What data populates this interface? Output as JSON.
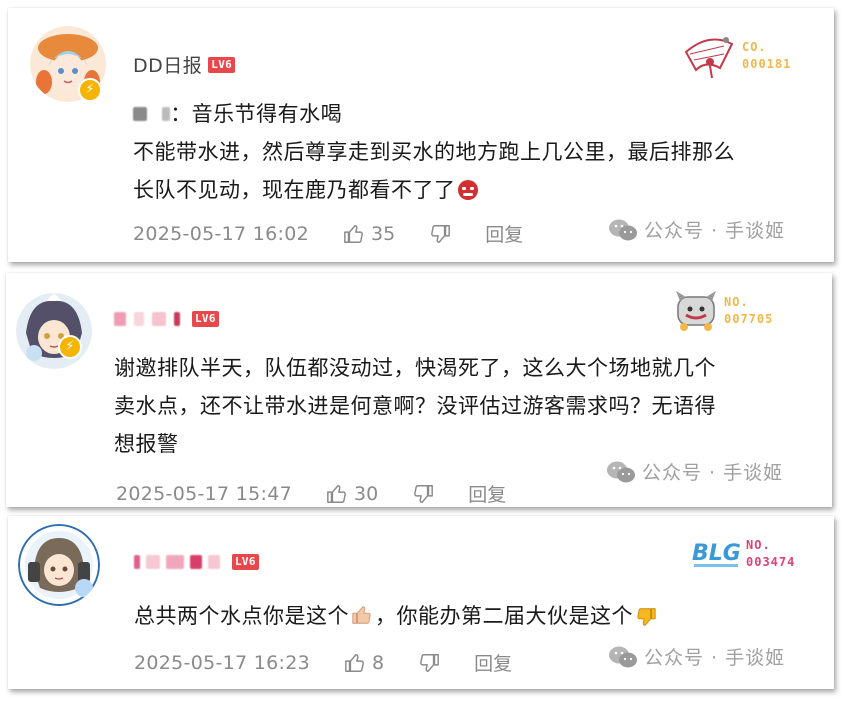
{
  "comments": [
    {
      "username": "DD日报",
      "level": "LV6",
      "reply_to": "：音乐节得有水喝",
      "text_lines": [
        "不能带水进，然后尊享走到买水的地方跑上几公里，最后排那么",
        "长队不见动，现在鹿乃都看不了了"
      ],
      "datetime": "2025-05-17 16:02",
      "likes": "35",
      "reply_label": "回复",
      "fan_label": "CO.",
      "fan_number": "000181",
      "fan_color": "#f0b84a"
    },
    {
      "username": "",
      "level": "LV6",
      "text_lines": [
        "谢邀排队半天，队伍都没动过，快渴死了，这么大个场地就几个",
        "卖水点，还不让带水进是何意啊？没评估过游客需求吗？无语得",
        "想报警"
      ],
      "datetime": "2025-05-17 15:47",
      "likes": "30",
      "reply_label": "回复",
      "fan_label": "NO.",
      "fan_number": "007705",
      "fan_color": "#f0b84a"
    },
    {
      "username": "",
      "level": "LV6",
      "text_parts": [
        "总共两个水点你是这个",
        "，你能办第二届大伙是这个"
      ],
      "datetime": "2025-05-17 16:23",
      "likes": "8",
      "reply_label": "回复",
      "fan_label": "NO.",
      "fan_number": "003474",
      "fan_color": "#e0407a"
    }
  ],
  "watermark": {
    "text": "公众号 · 手谈姬"
  },
  "icons": {
    "verified": "verified-badge-icon",
    "like": "thumbs-up-icon",
    "dislike": "thumbs-down-icon",
    "wechat": "wechat-icon",
    "angry": "angry-face-emoji",
    "thumbs_up_emoji": "thumbs-up-emoji",
    "thumbs_down_emoji": "thumbs-down-emoji"
  },
  "colors": {
    "level_badge": "#e8484c",
    "text": "#1a1a1a",
    "meta": "#8a8a8a",
    "verified": "#f5b400"
  }
}
